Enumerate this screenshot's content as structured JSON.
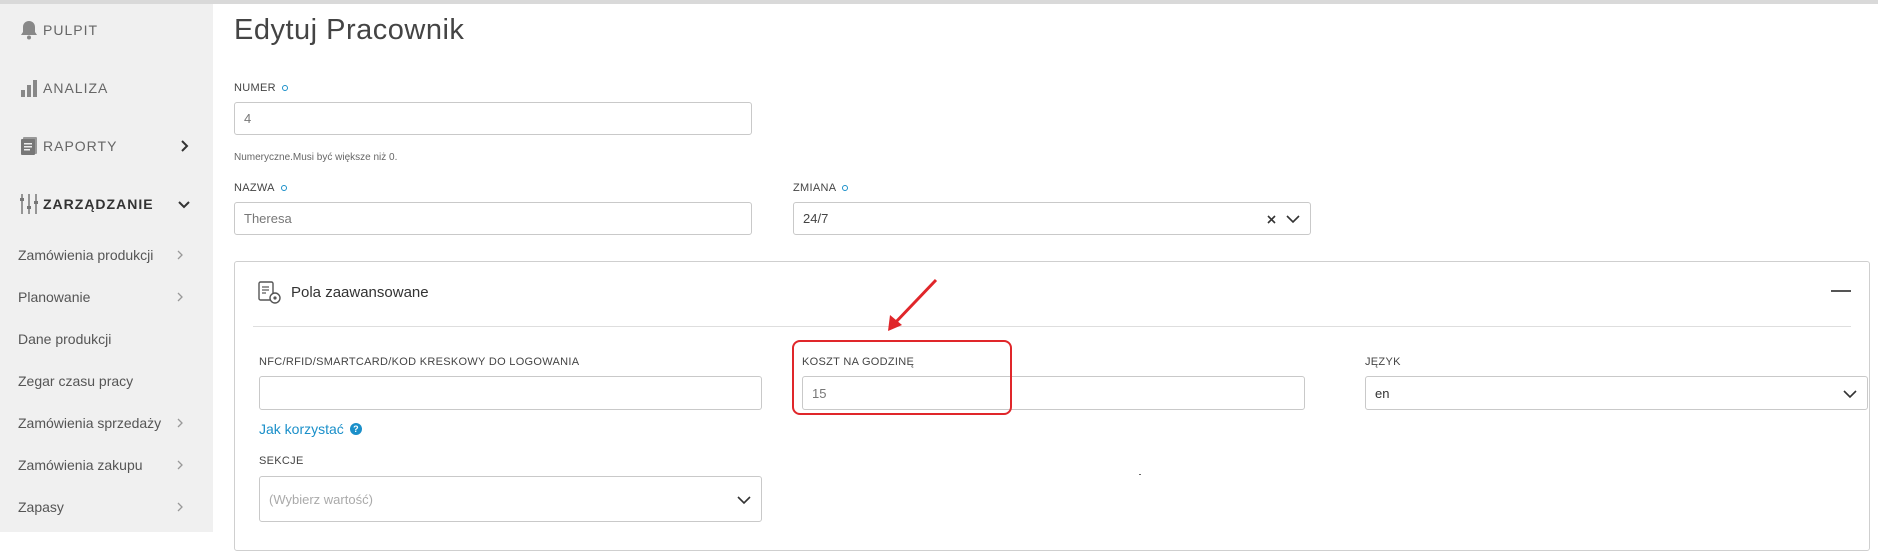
{
  "sidebar": {
    "main_items": [
      {
        "label": "PULPIT",
        "icon": "bell-icon"
      },
      {
        "label": "ANALIZA",
        "icon": "bar-chart-icon"
      },
      {
        "label": "RAPORTY",
        "icon": "report-icon"
      },
      {
        "label": "ZARZĄDZANIE",
        "icon": "sliders-icon"
      }
    ],
    "sub_items": [
      {
        "label": "Zamówienia produkcji",
        "has_chevron": true
      },
      {
        "label": "Planowanie",
        "has_chevron": true
      },
      {
        "label": "Dane produkcji",
        "has_chevron": false
      },
      {
        "label": "Zegar czasu pracy",
        "has_chevron": false
      },
      {
        "label": "Zamówienia sprzedaży",
        "has_chevron": true
      },
      {
        "label": "Zamówienia zakupu",
        "has_chevron": true
      },
      {
        "label": "Zapasy",
        "has_chevron": true
      }
    ]
  },
  "page": {
    "title": "Edytuj Pracownik"
  },
  "form": {
    "numer": {
      "label": "NUMER",
      "value": "4",
      "hint": "Numeryczne.Musi być większe niż 0."
    },
    "nazwa": {
      "label": "NAZWA",
      "value": "Theresa"
    },
    "zmiana": {
      "label": "ZMIANA",
      "value": "24/7"
    }
  },
  "advanced": {
    "title": "Pola zaawansowane",
    "nfc": {
      "label": "NFC/RFID/SMARTCARD/KOD KRESKOWY DO LOGOWANIA",
      "value": ""
    },
    "help_link": "Jak korzystać",
    "help_icon_glyph": "?",
    "koszt": {
      "label": "KOSZT NA GODZINĘ",
      "value": "15"
    },
    "jezyk": {
      "label": "JĘZYK",
      "value": "en"
    },
    "sekcje": {
      "label": "SEKCJE",
      "placeholder": "(Wybierz wartość)"
    }
  },
  "colors": {
    "accent": "#1a8fc9",
    "annotation": "#e0262a",
    "sidebar_bg": "#f0f0f0"
  }
}
